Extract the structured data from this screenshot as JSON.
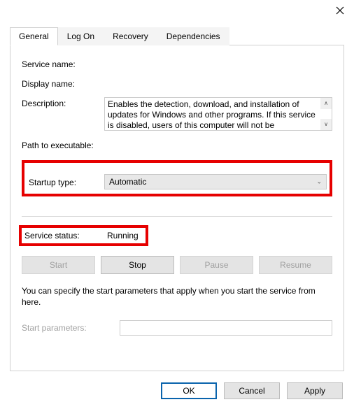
{
  "window": {
    "close_icon": "close"
  },
  "tabs": {
    "general": "General",
    "logon": "Log On",
    "recovery": "Recovery",
    "dependencies": "Dependencies"
  },
  "general": {
    "service_name_label": "Service name:",
    "service_name_value": "",
    "display_name_label": "Display name:",
    "display_name_value": "",
    "description_label": "Description:",
    "description_value": "Enables the detection, download, and installation of updates for Windows and other programs. If this service is disabled, users of this computer will not be",
    "path_label": "Path to executable:",
    "path_value": "",
    "startup_type_label": "Startup type:",
    "startup_type_value": "Automatic",
    "service_status_label": "Service status:",
    "service_status_value": "Running",
    "buttons": {
      "start": "Start",
      "stop": "Stop",
      "pause": "Pause",
      "resume": "Resume"
    },
    "param_note": "You can specify the start parameters that apply when you start the service from here.",
    "start_params_label": "Start parameters:",
    "start_params_value": ""
  },
  "footer": {
    "ok": "OK",
    "cancel": "Cancel",
    "apply": "Apply"
  }
}
